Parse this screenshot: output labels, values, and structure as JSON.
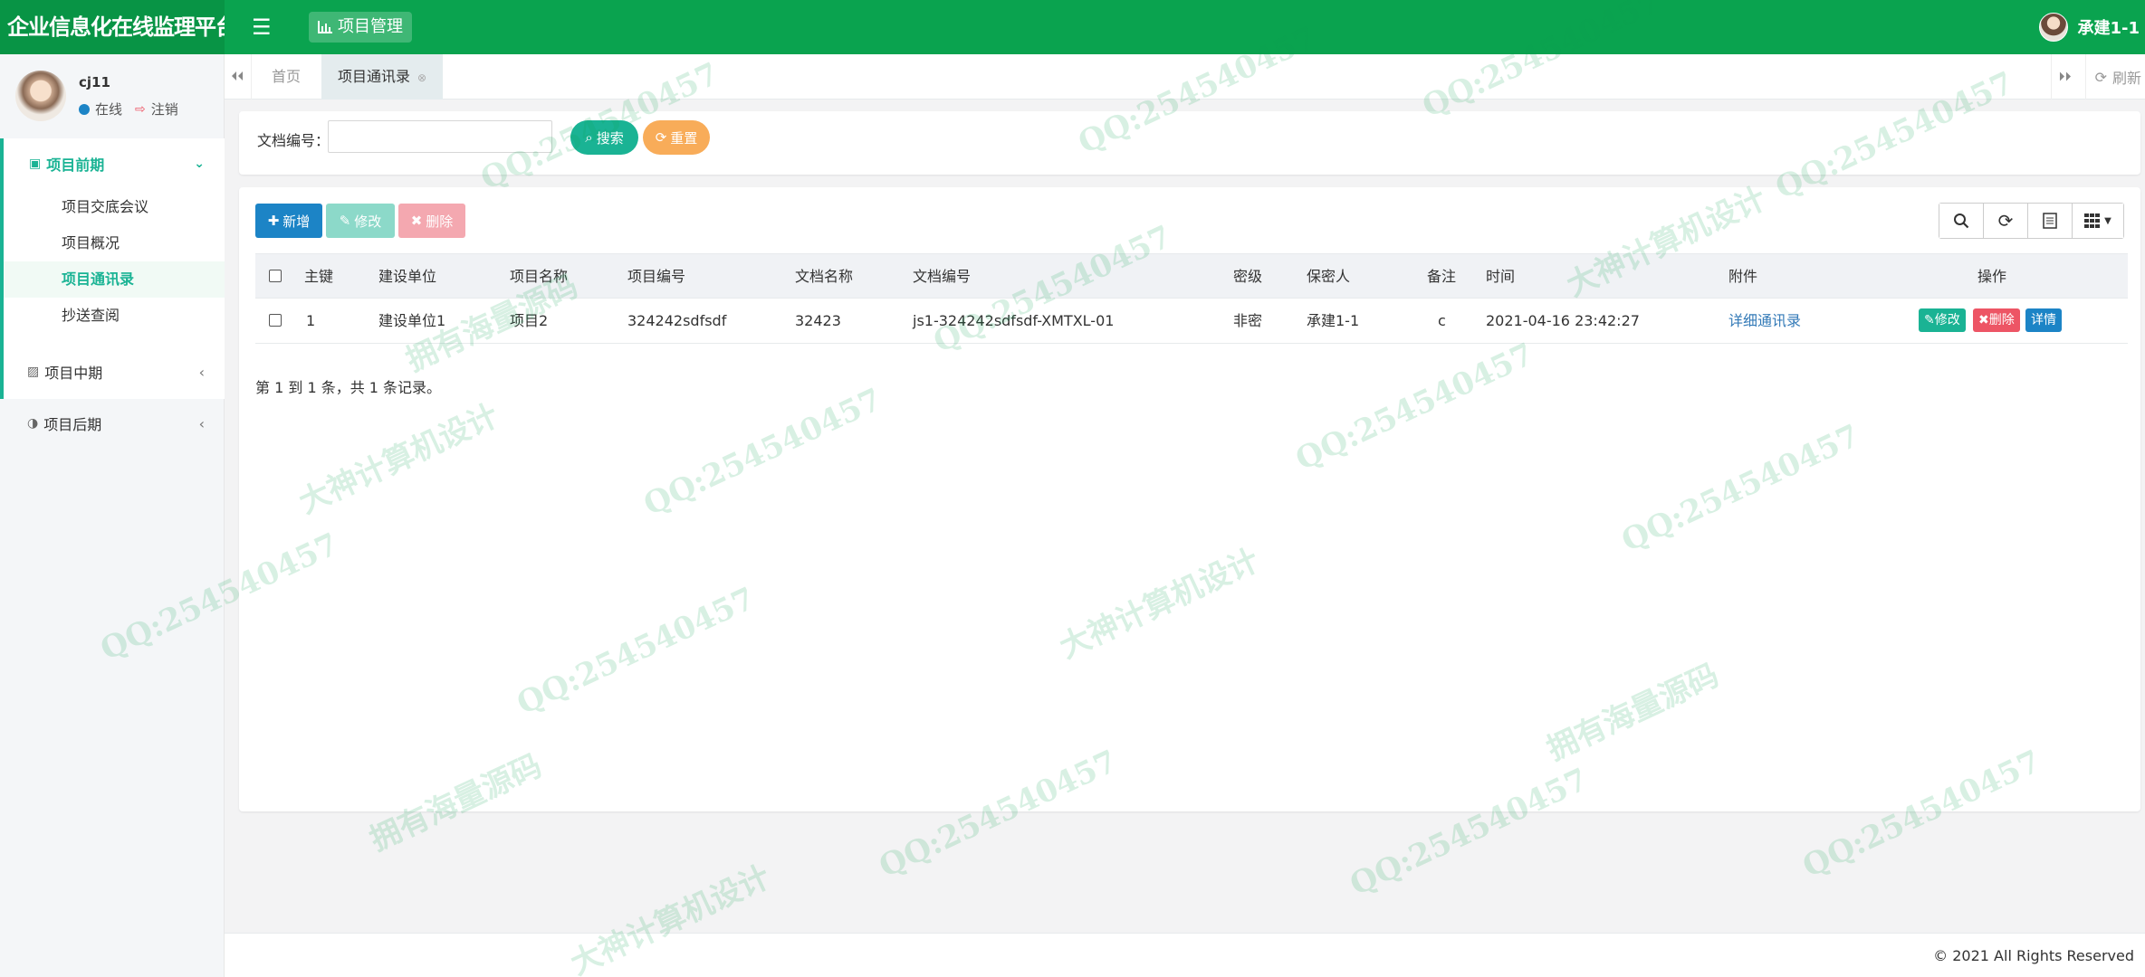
{
  "app": {
    "title": "企业信息化在线监理平台",
    "module": "项目管理",
    "user": "承建1-1"
  },
  "profile": {
    "name": "cj11",
    "status": "在线",
    "logout": "注销"
  },
  "sidebar": {
    "group": {
      "label": "项目前期",
      "items": [
        {
          "label": "项目交底会议"
        },
        {
          "label": "项目概况"
        },
        {
          "label": "项目通讯录"
        },
        {
          "label": "抄送查阅"
        }
      ]
    },
    "mid": "项目中期",
    "late": "项目后期"
  },
  "tabs": {
    "home": "首页",
    "current": "项目通讯录",
    "refresh": "刷新"
  },
  "search": {
    "label": "文档编号：",
    "placeholder": "",
    "value": "",
    "search_btn": "搜索",
    "reset_btn": "重置"
  },
  "toolbar": {
    "add": "新增",
    "edit": "修改",
    "delete": "删除"
  },
  "table": {
    "headers": [
      "主键",
      "建设单位",
      "项目名称",
      "项目编号",
      "文档名称",
      "文档编号",
      "密级",
      "保密人",
      "备注",
      "时间",
      "附件",
      "操作"
    ],
    "rows": [
      {
        "id": "1",
        "unit": "建设单位1",
        "project": "项目2",
        "project_no": "324242sdfsdf",
        "doc_name": "32423",
        "doc_no": "js1-324242sdfsdf-XMTXL-01",
        "level": "非密",
        "keeper": "承建1-1",
        "remark": "c",
        "time": "2021-04-16 23:42:27",
        "attachment": "详细通讯录",
        "ops": {
          "edit": "修改",
          "delete": "删除",
          "detail": "详情"
        }
      }
    ],
    "summary": "第 1 到 1 条，共 1 条记录。"
  },
  "footer": "© 2021 All Rights Reserved",
  "colors": {
    "brand": "#0aa34f",
    "accent": "#1ab394",
    "primary": "#1c84c6",
    "danger": "#ed5565",
    "warning": "#f8ac59"
  },
  "watermark": [
    "QQ:254540457",
    "拥有海量源码",
    "大神计算机设计"
  ]
}
